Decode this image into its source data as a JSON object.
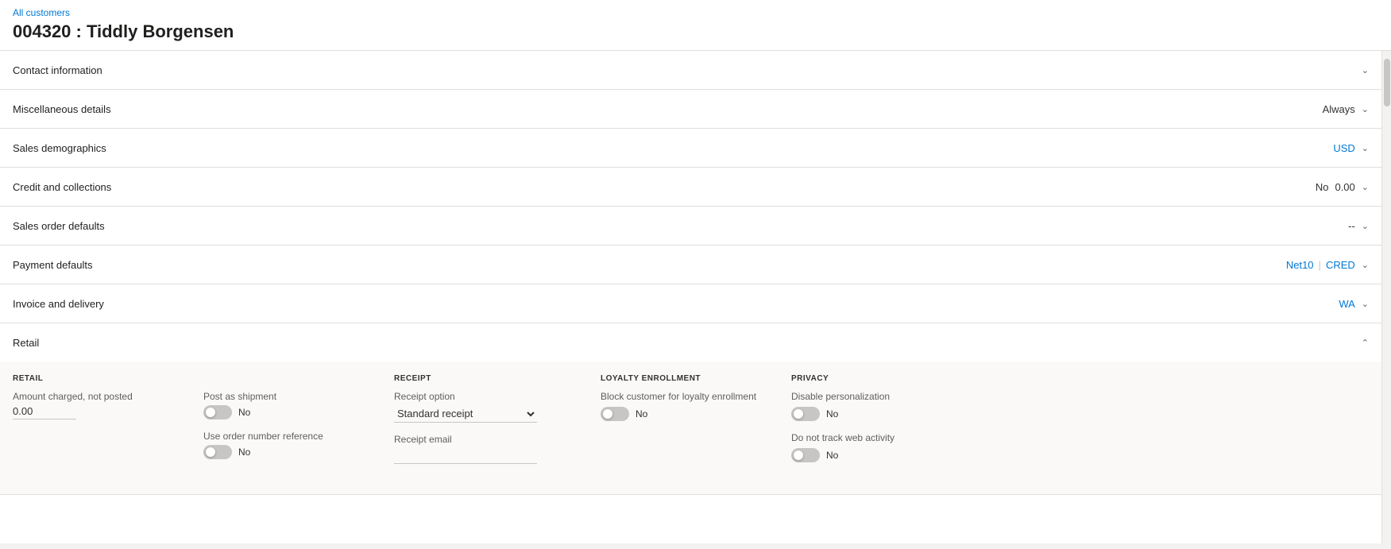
{
  "breadcrumb": "All customers",
  "page_title": "004320 : Tiddly Borgensen",
  "sections": [
    {
      "id": "contact-information",
      "label": "Contact information",
      "value": "",
      "value_blue": false,
      "expanded": false,
      "chevron": "down"
    },
    {
      "id": "miscellaneous-details",
      "label": "Miscellaneous details",
      "value": "Always",
      "value_blue": false,
      "expanded": false,
      "chevron": "down"
    },
    {
      "id": "sales-demographics",
      "label": "Sales demographics",
      "value": "USD",
      "value_blue": true,
      "expanded": false,
      "chevron": "down"
    },
    {
      "id": "credit-and-collections",
      "label": "Credit and collections",
      "value": "No",
      "value2": "0.00",
      "value_blue": false,
      "expanded": false,
      "chevron": "down"
    },
    {
      "id": "sales-order-defaults",
      "label": "Sales order defaults",
      "value": "--",
      "value_blue": false,
      "expanded": false,
      "chevron": "down"
    },
    {
      "id": "payment-defaults",
      "label": "Payment defaults",
      "value": "Net10",
      "value2": "CRED",
      "value_blue": true,
      "expanded": false,
      "chevron": "down"
    },
    {
      "id": "invoice-and-delivery",
      "label": "Invoice and delivery",
      "value": "WA",
      "value_blue": true,
      "expanded": false,
      "chevron": "down"
    },
    {
      "id": "retail",
      "label": "Retail",
      "value": "",
      "value_blue": false,
      "expanded": true,
      "chevron": "up"
    }
  ],
  "retail": {
    "retail_col_label": "RETAIL",
    "amount_label": "Amount charged, not posted",
    "amount_value": "0.00",
    "post_shipment_label": "Post as shipment",
    "post_shipment_value": "No",
    "use_order_ref_label": "Use order number reference",
    "use_order_ref_value": "No",
    "receipt_col_label": "RECEIPT",
    "receipt_option_label": "Receipt option",
    "receipt_option_value": "Standard receipt",
    "receipt_email_label": "Receipt email",
    "receipt_email_value": "",
    "loyalty_col_label": "LOYALTY ENROLLMENT",
    "block_loyalty_label": "Block customer for loyalty enrollment",
    "block_loyalty_value": "No",
    "privacy_col_label": "PRIVACY",
    "disable_personalization_label": "Disable personalization",
    "disable_personalization_value": "No",
    "do_not_track_label": "Do not track web activity",
    "do_not_track_value": "No"
  }
}
